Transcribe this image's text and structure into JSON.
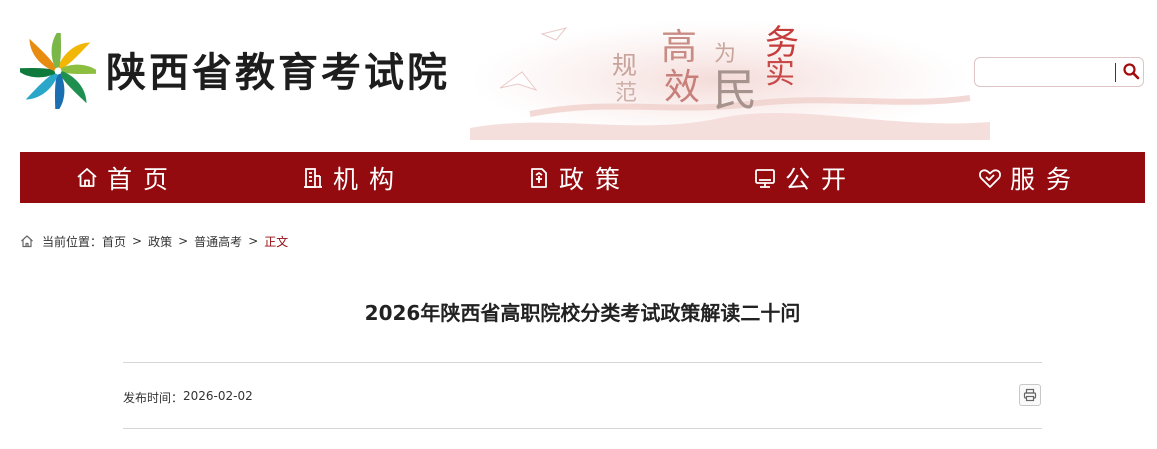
{
  "header": {
    "site_title": "陕西省教育考试院",
    "slogan": {
      "c1": "规",
      "c2": "高",
      "c3": "为",
      "c4": "务",
      "c5": "范",
      "c6": "效",
      "c7": "民",
      "c8": "实"
    },
    "search": {
      "value": "",
      "placeholder": ""
    }
  },
  "nav": {
    "items": [
      {
        "label": "首页",
        "icon": "home-icon"
      },
      {
        "label": "机构",
        "icon": "building-icon"
      },
      {
        "label": "政策",
        "icon": "document-icon"
      },
      {
        "label": "公开",
        "icon": "monitor-icon"
      },
      {
        "label": "服务",
        "icon": "heart-hand-icon"
      }
    ]
  },
  "breadcrumb": {
    "prefix": "当前位置：",
    "items": [
      "首页",
      "政策",
      "普通高考",
      "正文"
    ],
    "separator": ">"
  },
  "article": {
    "title": "2026年陕西省高职院校分类考试政策解读二十问",
    "publish_label": "发布时间：",
    "publish_date": "2026-02-02"
  },
  "colors": {
    "brand_red": "#930b0f",
    "nav_text": "#ffffff",
    "current_crumb": "#930b0f"
  }
}
